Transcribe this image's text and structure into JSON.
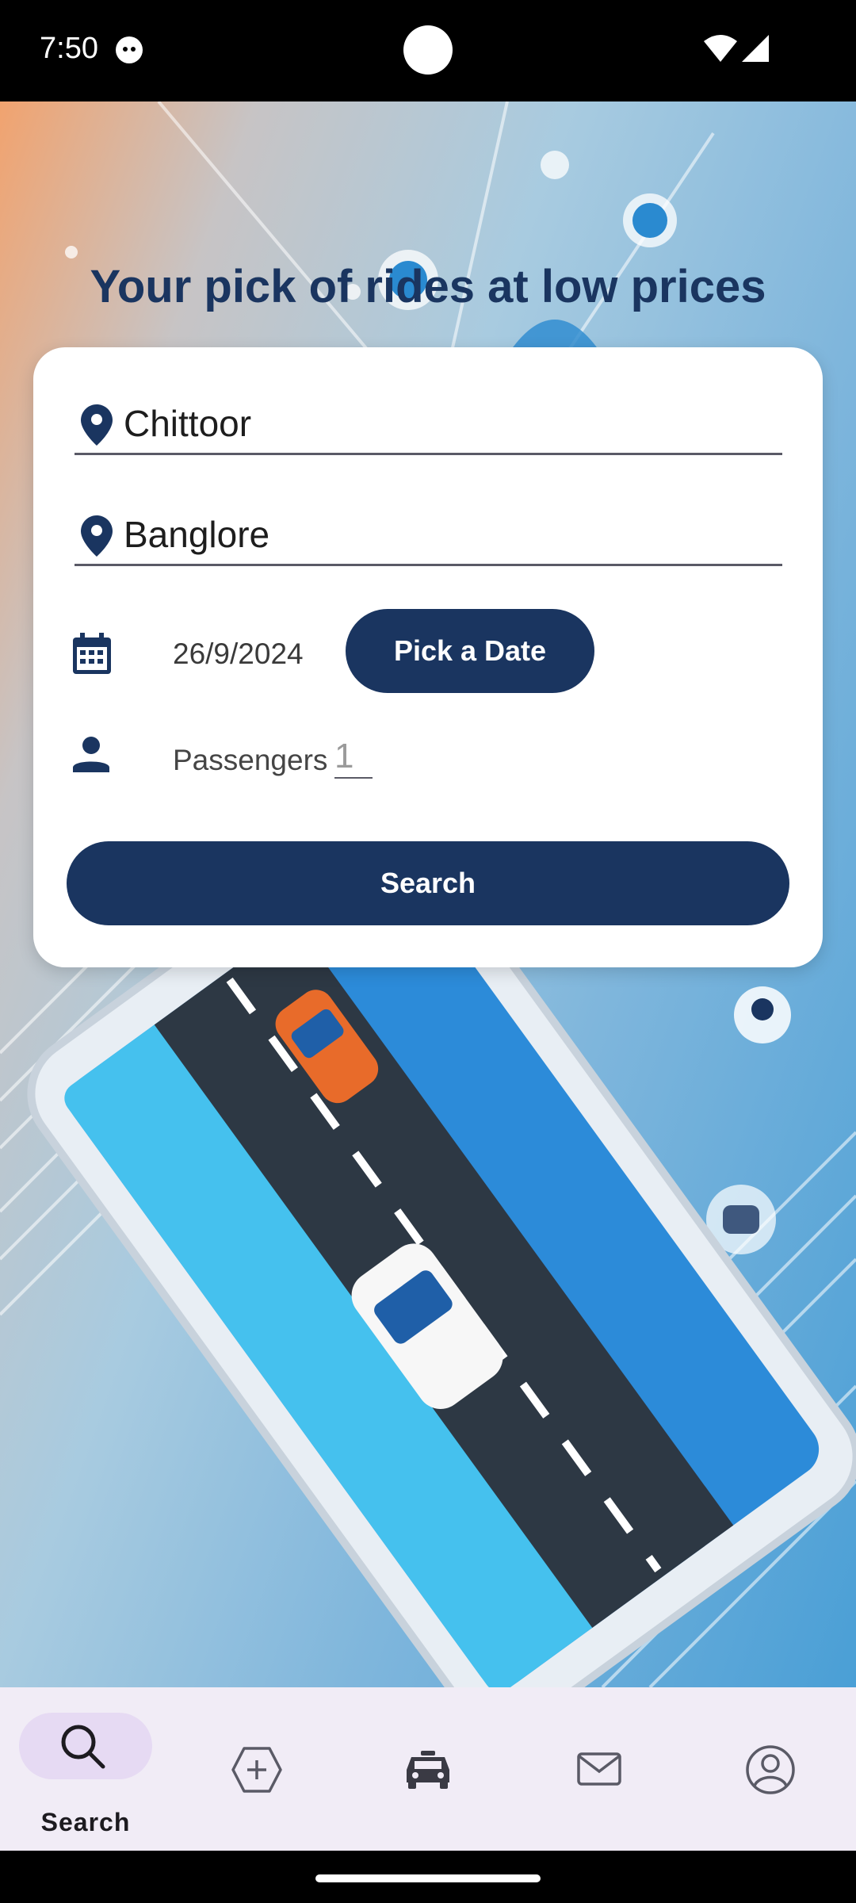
{
  "status_bar": {
    "time": "7:50"
  },
  "headline": "Your pick of rides at low prices",
  "form": {
    "from_value": "Chittoor",
    "to_value": "Banglore",
    "date_value": "26/9/2024",
    "pick_date_label": "Pick a Date",
    "passengers_label": "Passengers",
    "passengers_value": "1",
    "search_label": "Search"
  },
  "bottom_nav": {
    "items": [
      {
        "label": "Search",
        "icon": "search-icon",
        "active": true
      },
      {
        "label": "",
        "icon": "add-ride-icon",
        "active": false
      },
      {
        "label": "",
        "icon": "car-icon",
        "active": false
      },
      {
        "label": "",
        "icon": "mail-icon",
        "active": false
      },
      {
        "label": "",
        "icon": "profile-icon",
        "active": false
      }
    ]
  },
  "colors": {
    "primary": "#1a3560",
    "nav_bg": "#f1ecf6",
    "nav_pill": "#e6daf3",
    "card": "#ffffff"
  }
}
